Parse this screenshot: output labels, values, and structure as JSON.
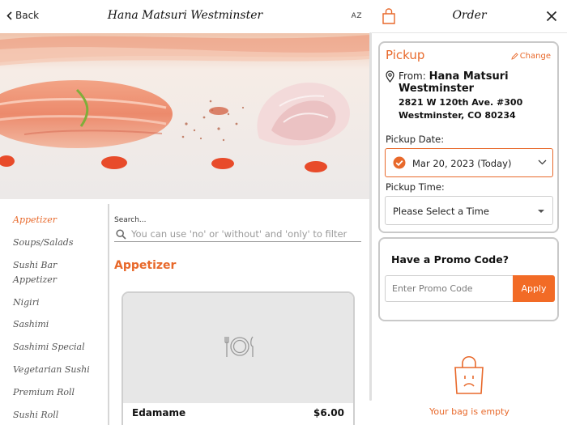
{
  "header": {
    "back_label": "Back",
    "restaurant_title": "Hana Matsuri Westminster",
    "sort_label": "AZ"
  },
  "categories": [
    {
      "label": "Appetizer",
      "active": true
    },
    {
      "label": "Soups/Salads",
      "active": false
    },
    {
      "label": "Sushi Bar Appetizer",
      "active": false
    },
    {
      "label": "Nigiri",
      "active": false
    },
    {
      "label": "Sashimi",
      "active": false
    },
    {
      "label": "Sashimi Special",
      "active": false
    },
    {
      "label": "Vegetarian Sushi",
      "active": false
    },
    {
      "label": "Premium Roll",
      "active": false
    },
    {
      "label": "Sushi Roll",
      "active": false
    }
  ],
  "search": {
    "label": "Search...",
    "placeholder": "You can use 'no' or 'without' and 'only' to filter"
  },
  "menu": {
    "section_title": "Appetizer",
    "items": [
      {
        "name": "Edamame",
        "price": "$6.00"
      }
    ]
  },
  "order": {
    "title": "Order",
    "pickup": {
      "title": "Pickup",
      "change_label": "Change",
      "from_prefix": "From:",
      "restaurant_name": "Hana Matsuri Westminster",
      "address_line1": "2821 W 120th Ave. #300",
      "address_line2": "Westminster, CO 80234",
      "date_label": "Pickup Date:",
      "date_value": "Mar 20, 2023 (Today)",
      "time_label": "Pickup Time:",
      "time_value": "Please Select a Time"
    },
    "promo": {
      "title": "Have a Promo Code?",
      "placeholder": "Enter Promo Code",
      "apply_label": "Apply"
    },
    "empty_message": "Your bag is empty"
  },
  "colors": {
    "accent": "#e8692b",
    "apply_button": "#f26b26"
  }
}
